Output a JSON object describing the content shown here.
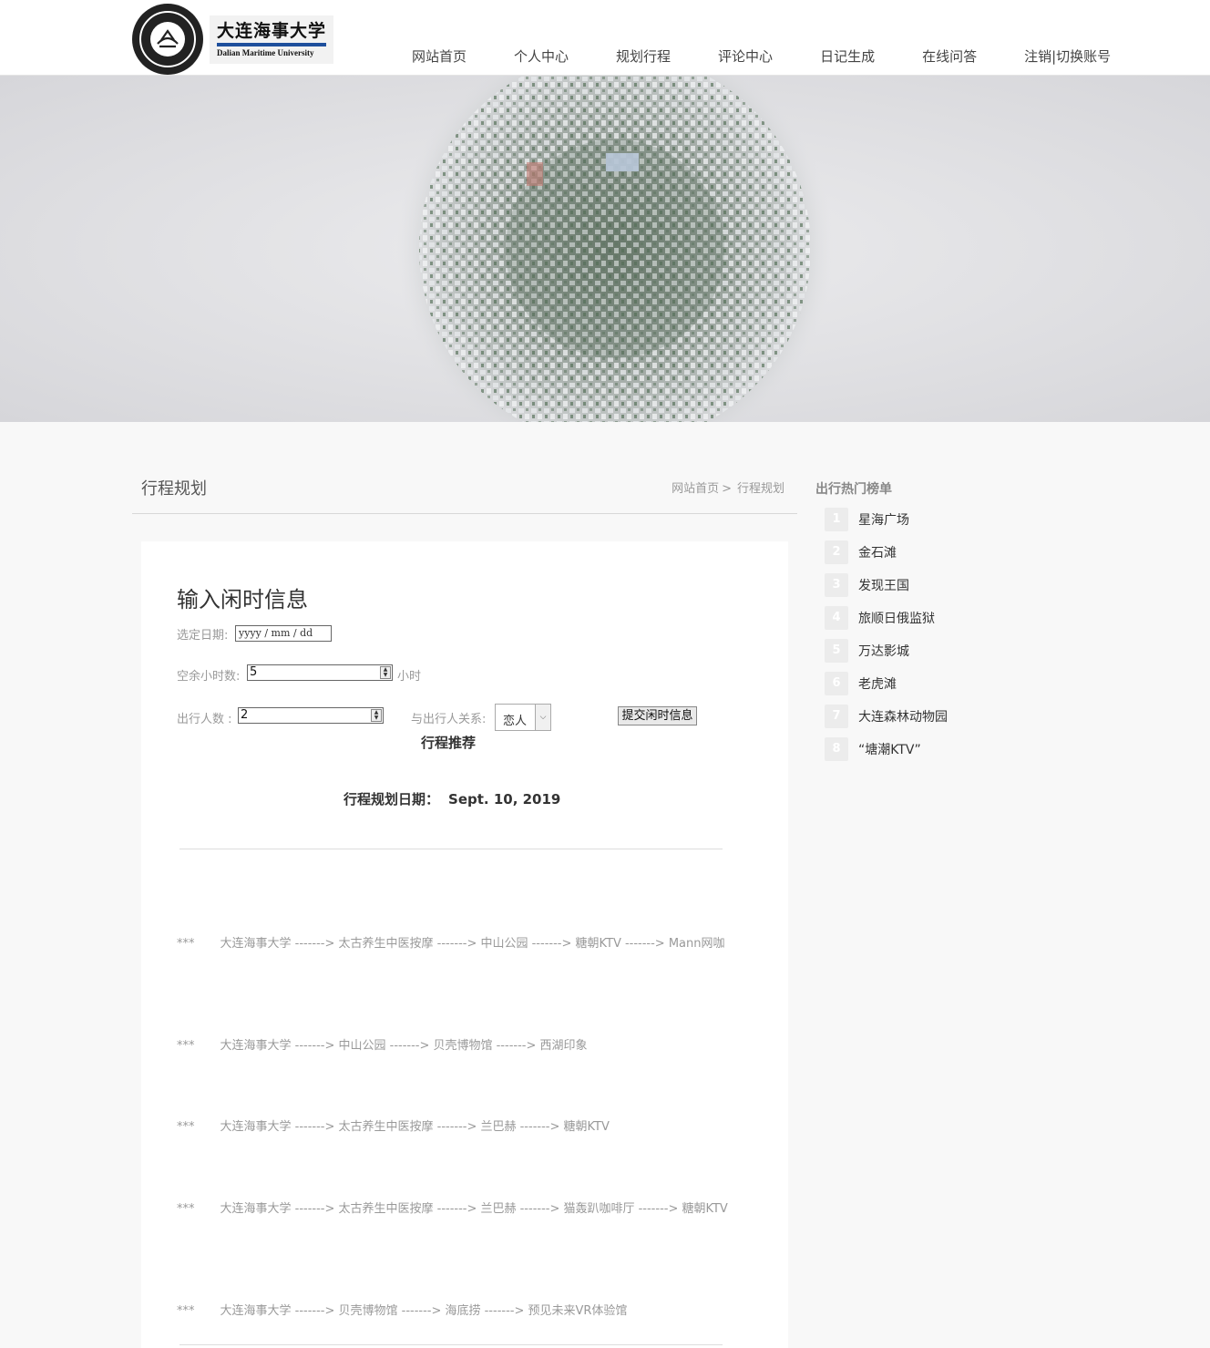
{
  "header": {
    "logo_cn": "大连海事大学",
    "logo_en": "Dalian Maritime University",
    "nav": [
      "网站首页",
      "个人中心",
      "规划行程",
      "评论中心",
      "日记生成",
      "在线问答",
      "注销|切换账号"
    ]
  },
  "section": {
    "title": "行程规划",
    "breadcrumb": {
      "home": "网站首页",
      "sep": ">",
      "current": "行程规划"
    }
  },
  "form": {
    "title": "输入闲时信息",
    "date_label": "选定日期:",
    "date_placeholder": "yyyy / mm / dd",
    "hours_label": "空余小时数:",
    "hours_value": "5",
    "hours_unit": "小时",
    "people_label": "出行人数 :",
    "people_value": "2",
    "relation_label": "与出行人关系:",
    "relation_value": "恋人",
    "submit": "提交闲时信息"
  },
  "recommend": {
    "title": "行程推荐",
    "date_label": "行程规划日期：",
    "date_value": "Sept. 10, 2019",
    "routes": [
      {
        "star": "***",
        "text": "大连海事大学 -------> 太古养生中医按摩 -------> 中山公园 -------> 糖朝KTV -------> Mann网咖"
      },
      {
        "star": "***",
        "text": "大连海事大学 -------> 中山公园 -------> 贝壳博物馆 -------> 西湖印象"
      },
      {
        "star": "***",
        "text": "大连海事大学 -------> 太古养生中医按摩 -------> 兰巴赫 -------> 糖朝KTV"
      },
      {
        "star": "***",
        "text": "大连海事大学 -------> 太古养生中医按摩 -------> 兰巴赫 -------> 猫轰趴咖啡厅 -------> 糖朝KTV"
      },
      {
        "star": "***",
        "text": "大连海事大学 -------> 贝壳博物馆 -------> 海底捞 -------> 预见未来VR体验馆"
      }
    ]
  },
  "sidebar": {
    "title": "出行热门榜单",
    "items": [
      {
        "num": "1",
        "name": "星海广场"
      },
      {
        "num": "2",
        "name": "金石滩"
      },
      {
        "num": "3",
        "name": "发现王国"
      },
      {
        "num": "4",
        "name": "旅顺日俄监狱"
      },
      {
        "num": "5",
        "name": "万达影城"
      },
      {
        "num": "6",
        "name": "老虎滩"
      },
      {
        "num": "7",
        "name": "大连森林动物园"
      },
      {
        "num": "8",
        "name": "“塘潮KTV”"
      }
    ]
  }
}
